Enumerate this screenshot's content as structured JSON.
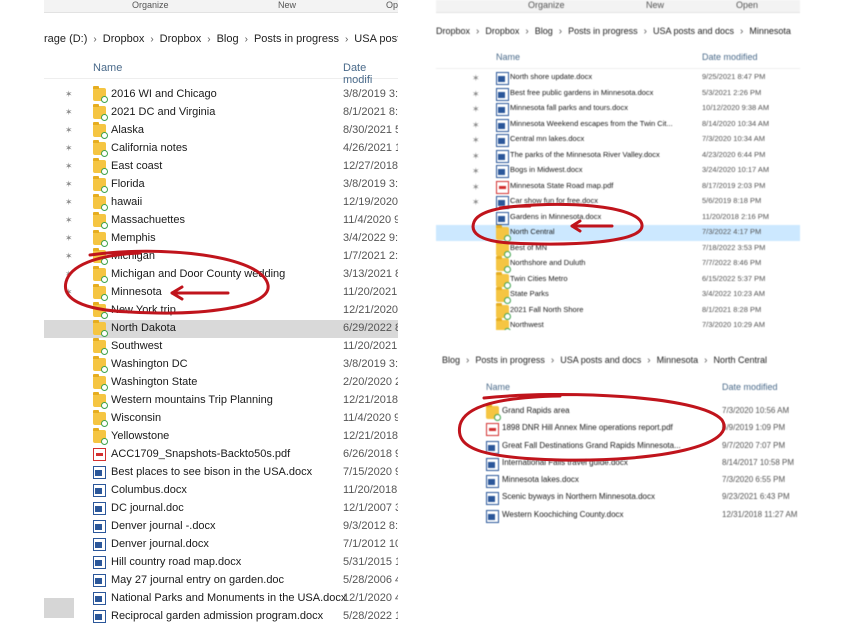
{
  "left": {
    "ribbon": [
      "Organize",
      "New",
      "Op"
    ],
    "breadcrumb": [
      "rage (D:)",
      "Dropbox",
      "Dropbox",
      "Blog",
      "Posts in progress",
      "USA posts"
    ],
    "columns": {
      "name": "Name",
      "date": "Date modifi"
    },
    "rows": [
      {
        "name": "2016 WI and Chicago",
        "date": "3/8/2019 3:",
        "type": "folder"
      },
      {
        "name": "2021 DC and Virginia",
        "date": "8/1/2021 8:",
        "type": "folder"
      },
      {
        "name": "Alaska",
        "date": "8/30/2021 5",
        "type": "folder"
      },
      {
        "name": "California notes",
        "date": "4/26/2021 1",
        "type": "folder"
      },
      {
        "name": "East coast",
        "date": "12/27/2018",
        "type": "folder"
      },
      {
        "name": "Florida",
        "date": "3/8/2019 3:",
        "type": "folder"
      },
      {
        "name": "hawaii",
        "date": "12/19/2020",
        "type": "folder"
      },
      {
        "name": "Massachuettes",
        "date": "11/4/2020 9",
        "type": "folder"
      },
      {
        "name": "Memphis",
        "date": "3/4/2022 9:",
        "type": "folder"
      },
      {
        "name": "Michigan",
        "date": "1/7/2021 2:",
        "type": "folder"
      },
      {
        "name": "Michigan and Door County wedding",
        "date": "3/13/2021 8",
        "type": "folder"
      },
      {
        "name": "Minnesota",
        "date": "11/20/2021",
        "type": "folder"
      },
      {
        "name": "New York trip",
        "date": "12/21/2020",
        "type": "folder"
      },
      {
        "name": "North Dakota",
        "date": "6/29/2022 8",
        "type": "folder"
      },
      {
        "name": "Southwest",
        "date": "11/20/2021",
        "type": "folder"
      },
      {
        "name": "Washington DC",
        "date": "3/8/2019 3:",
        "type": "folder"
      },
      {
        "name": "Washington State",
        "date": "2/20/2020 2",
        "type": "folder"
      },
      {
        "name": "Western mountains Trip Planning",
        "date": "12/21/2018",
        "type": "folder"
      },
      {
        "name": "Wisconsin",
        "date": "11/4/2020 9",
        "type": "folder"
      },
      {
        "name": "Yellowstone",
        "date": "12/21/2018",
        "type": "folder"
      },
      {
        "name": "ACC1709_Snapshots-Backto50s.pdf",
        "date": "6/26/2018 9",
        "type": "pdf"
      },
      {
        "name": "Best places to see bison in the USA.docx",
        "date": "7/15/2020 9",
        "type": "docx"
      },
      {
        "name": "Columbus.docx",
        "date": "11/20/2018",
        "type": "docx"
      },
      {
        "name": "DC journal.doc",
        "date": "12/1/2007 3",
        "type": "docx"
      },
      {
        "name": "Denver journal -.docx",
        "date": "9/3/2012 8:",
        "type": "docx"
      },
      {
        "name": "Denver journal.docx",
        "date": "7/1/2012 10",
        "type": "docx"
      },
      {
        "name": "Hill country road map.docx",
        "date": "5/31/2015 1",
        "type": "docx"
      },
      {
        "name": "May 27 journal entry on garden.doc",
        "date": "5/28/2006 4",
        "type": "docx"
      },
      {
        "name": "National Parks and Monuments in the USA.docx",
        "date": "12/1/2020 4",
        "type": "docx"
      },
      {
        "name": "Reciprocal garden admission program.docx",
        "date": "5/28/2022 1",
        "type": "docx"
      }
    ]
  },
  "right_top": {
    "ribbon": [
      "Organize",
      "New",
      "Open"
    ],
    "breadcrumb": [
      "Dropbox",
      "Dropbox",
      "Blog",
      "Posts in progress",
      "USA posts and docs",
      "Minnesota"
    ],
    "columns": {
      "name": "Name",
      "date": "Date modified"
    },
    "rows": [
      {
        "name": "North shore update.docx",
        "date": "9/25/2021 8:47 PM",
        "type": "docx"
      },
      {
        "name": "Best free public gardens in Minnesota.docx",
        "date": "5/3/2021 2:26 PM",
        "type": "docx"
      },
      {
        "name": "Minnesota fall parks and tours.docx",
        "date": "10/12/2020 9:38 AM",
        "type": "docx"
      },
      {
        "name": "Minnesota Weekend escapes from the Twin Cit...",
        "date": "8/14/2020 10:34 AM",
        "type": "docx"
      },
      {
        "name": "Central mn lakes.docx",
        "date": "7/3/2020 10:34 AM",
        "type": "docx"
      },
      {
        "name": "The parks of the Minnesota River Valley.docx",
        "date": "4/23/2020 6:44 PM",
        "type": "docx"
      },
      {
        "name": "Bogs in Midwest.docx",
        "date": "3/24/2020 10:17 AM",
        "type": "docx"
      },
      {
        "name": "Minnesota State Road map.pdf",
        "date": "8/17/2019 2:03 PM",
        "type": "pdf"
      },
      {
        "name": "Car show fun for free.docx",
        "date": "5/6/2019 8:18 PM",
        "type": "docx"
      },
      {
        "name": "Gardens in Minnesota.docx",
        "date": "11/20/2018 2:16 PM",
        "type": "docx"
      },
      {
        "name": "North Central",
        "date": "7/3/2022 4:17 PM",
        "type": "folder"
      },
      {
        "name": "Best of MN",
        "date": "7/18/2022 3:53 PM",
        "type": "folder"
      },
      {
        "name": "Northshore and Duluth",
        "date": "7/7/2022 8:46 PM",
        "type": "folder"
      },
      {
        "name": "Twin Cities Metro",
        "date": "6/15/2022 5:37 PM",
        "type": "folder"
      },
      {
        "name": "State Parks",
        "date": "3/4/2022 10:23 AM",
        "type": "folder"
      },
      {
        "name": "2021 Fall North Shore",
        "date": "8/1/2021 8:28 PM",
        "type": "folder"
      },
      {
        "name": "Northwest",
        "date": "7/3/2020 10:29 AM",
        "type": "folder"
      }
    ]
  },
  "right_bottom": {
    "breadcrumb": [
      "Blog",
      "Posts in progress",
      "USA posts and docs",
      "Minnesota",
      "North Central"
    ],
    "columns": {
      "name": "Name",
      "date": "Date modified"
    },
    "rows": [
      {
        "name": "Grand Rapids area",
        "date": "7/3/2020 10:56 AM",
        "type": "folder"
      },
      {
        "name": "1898 DNR Hill Annex Mine operations report.pdf",
        "date": "6/9/2019 1:09 PM",
        "type": "pdf"
      },
      {
        "name": "Great Fall Destinations Grand Rapids Minnesota...",
        "date": "9/7/2020 7:07 PM",
        "type": "docx"
      },
      {
        "name": "International Falls travel guide.docx",
        "date": "8/14/2017 10:58 PM",
        "type": "docx"
      },
      {
        "name": "Minnesota lakes.docx",
        "date": "7/3/2020 6:55 PM",
        "type": "docx"
      },
      {
        "name": "Scenic byways in Northern Minnesota.docx",
        "date": "9/23/2021 6:43 PM",
        "type": "docx"
      },
      {
        "name": "Western Koochiching County.docx",
        "date": "12/31/2018 11:27 AM",
        "type": "docx"
      }
    ]
  },
  "colors": {
    "annotation": "#c0141c",
    "selected": "#d9d9d9",
    "highlight": "#cce8ff",
    "folder": "#f5c542"
  }
}
